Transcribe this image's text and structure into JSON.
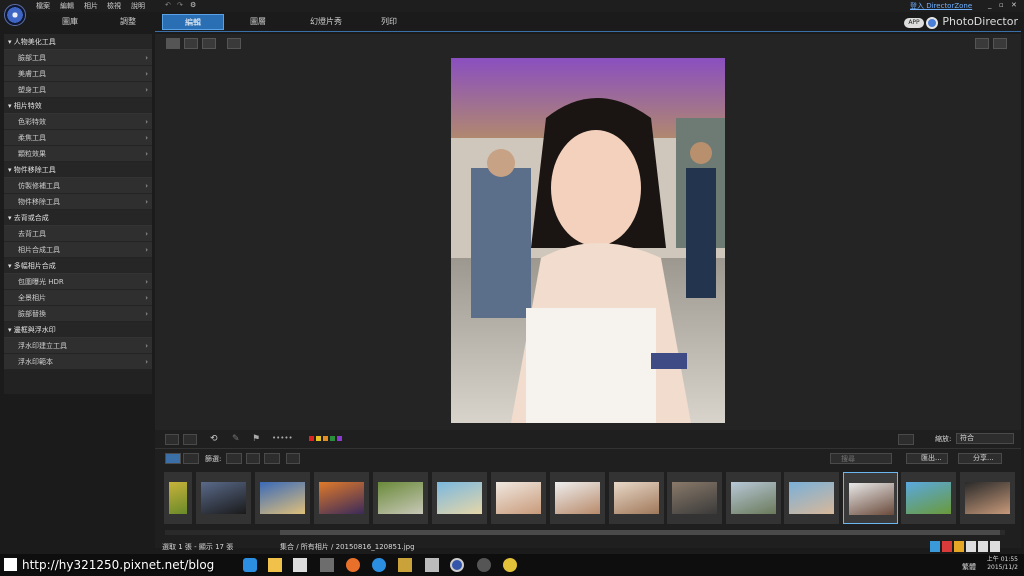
{
  "menu": [
    "檔案",
    "編輯",
    "相片",
    "檢視",
    "說明"
  ],
  "top_link": "登入 DirectorZone",
  "left_tabs": [
    "圖庫",
    "調整"
  ],
  "main_tabs": [
    "編輯",
    "圖層",
    "幻燈片秀",
    "列印"
  ],
  "active_tab": "編輯",
  "brand": {
    "app_badge": "APP",
    "name": "PhotoDirector"
  },
  "sidebar": [
    {
      "title": "人物美化工具",
      "items": [
        "臉部工具",
        "美膚工具",
        "塑身工具"
      ]
    },
    {
      "title": "相片特效",
      "items": [
        "色彩特效",
        "柔焦工具",
        "顆粒效果"
      ]
    },
    {
      "title": "物件移除工具",
      "items": [
        "仿製修補工具",
        "物件移除工具"
      ]
    },
    {
      "title": "去背或合成",
      "items": [
        "去背工具",
        "相片合成工具"
      ]
    },
    {
      "title": "多幅相片合成",
      "items": [
        "包圍曝光 HDR",
        "全景相片",
        "臉部替換"
      ]
    },
    {
      "title": "邊框與浮水印",
      "items": [
        "浮水印建立工具",
        "浮水印範本"
      ]
    }
  ],
  "toolbar": {
    "filter_label": "篩選:",
    "zoom_label": "縮放:",
    "zoom_value": "符合",
    "search_placeholder": "搜尋",
    "export_label": "匯出...",
    "share_label": "分享..."
  },
  "status": {
    "selection": "選取 1 張 - 顯示 17 張",
    "path": "集合 / 所有相片 / 20150816_120851.jpg"
  },
  "colors": {
    "accent": "#2a6fb3",
    "selected": "#6cb6f0"
  },
  "taskbar": {
    "url": "http://hy321250.pixnet.net/blog",
    "time": "上午 01:55",
    "date": "2015/11/2",
    "lang": "繁體"
  }
}
